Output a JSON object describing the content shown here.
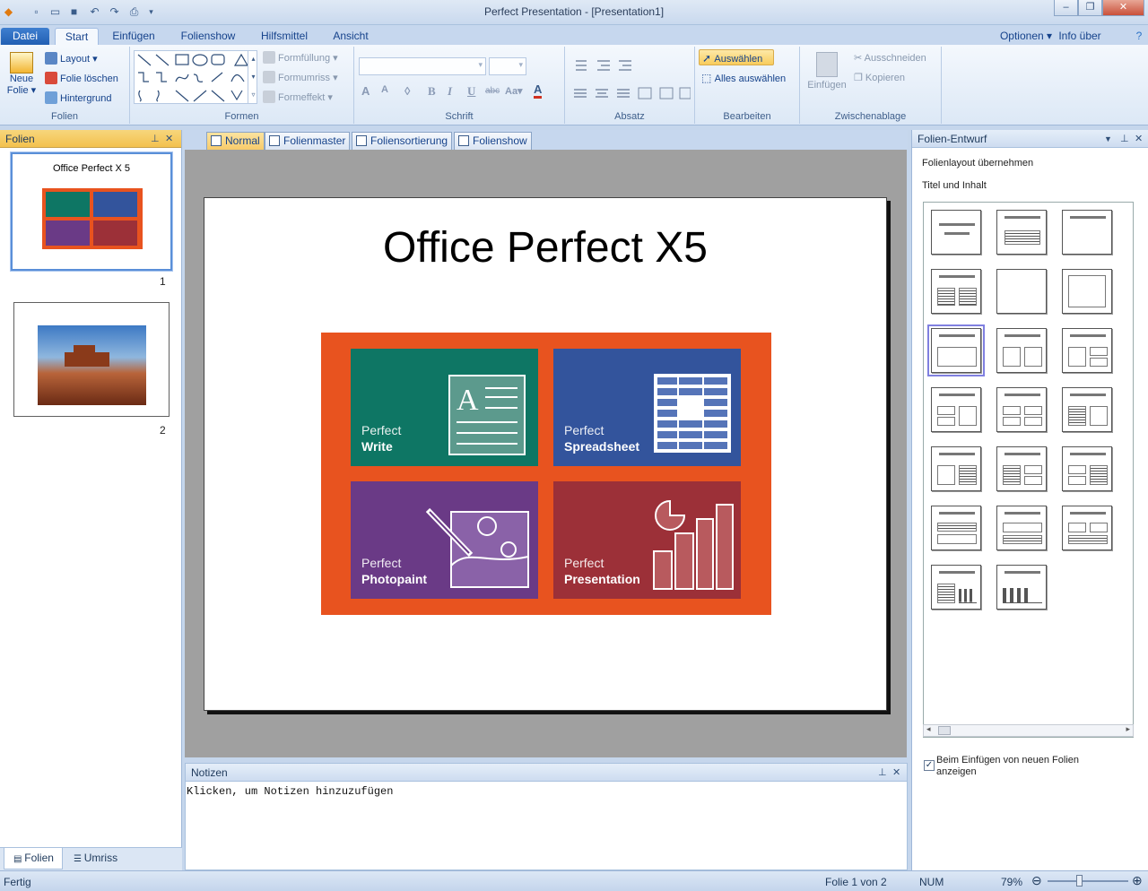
{
  "window": {
    "title": "Perfect Presentation - [Presentation1]"
  },
  "tabs": [
    "Datei",
    "Start",
    "Einfügen",
    "Folienshow",
    "Hilfsmittel",
    "Ansicht"
  ],
  "tabs_right": {
    "options": "Optionen",
    "info": "Info über"
  },
  "ribbon": {
    "folien": {
      "new_slide_1": "Neue",
      "new_slide_2": "Folie",
      "layout": "Layout",
      "delete": "Folie löschen",
      "background": "Hintergrund",
      "label": "Folien"
    },
    "formen": {
      "fill": "Formfüllung",
      "outline": "Formumriss",
      "effect": "Formeffekt",
      "label": "Formen"
    },
    "schrift": {
      "label": "Schrift"
    },
    "absatz": {
      "label": "Absatz"
    },
    "bearbeiten": {
      "select": "Auswählen",
      "select_all": "Alles auswählen",
      "label": "Bearbeiten"
    },
    "zwischenablage": {
      "paste": "Einfügen",
      "cut": "Ausschneiden",
      "copy": "Kopieren",
      "label": "Zwischenablage"
    }
  },
  "slides_pane": {
    "title": "Folien",
    "thumb1_title": "Office Perfect X 5",
    "num1": "1",
    "num2": "2",
    "tab_slides": "Folien",
    "tab_outline": "Umriss"
  },
  "view_tabs": [
    "Normal",
    "Folienmaster",
    "Foliensortierung",
    "Folienshow"
  ],
  "slide": {
    "title": "Office Perfect X5",
    "tiles": [
      {
        "line1": "Perfect",
        "line2": "Write",
        "color": "#0e7664"
      },
      {
        "line1": "Perfect",
        "line2": "Spreadsheet",
        "color": "#33549c"
      },
      {
        "line1": "Perfect",
        "line2": "Photopaint",
        "color": "#6a3a86"
      },
      {
        "line1": "Perfect",
        "line2": "Presentation",
        "color": "#9c3038"
      }
    ],
    "logo_bg": "#e8531f"
  },
  "notes": {
    "title": "Notizen",
    "placeholder": "Klicken, um Notizen hinzuzufügen"
  },
  "design_pane": {
    "title": "Folien-Entwurf",
    "apply_layout": "Folienlayout übernehmen",
    "current_layout": "Titel und Inhalt",
    "checkbox_label_1": "Beim Einfügen von neuen Folien",
    "checkbox_label_2": "anzeigen",
    "checkbox_checked": true
  },
  "status": {
    "ready": "Fertig",
    "slide_pos": "Folie 1 von 2",
    "num": "NUM",
    "zoom": "79%"
  }
}
